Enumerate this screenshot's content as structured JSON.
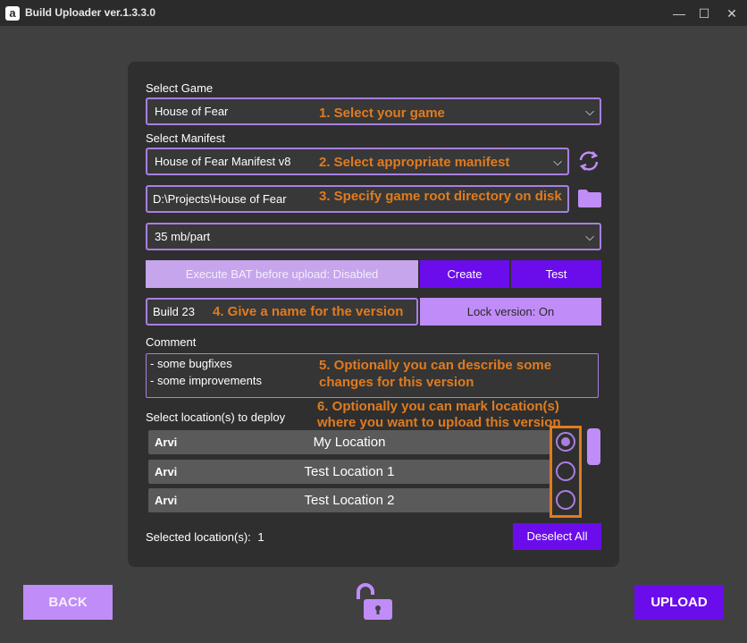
{
  "window": {
    "app_icon_letter": "a",
    "title": "Build Uploader ver.1.3.3.0",
    "minimize": "—",
    "maximize": "☐",
    "close": "✕"
  },
  "form": {
    "select_game_label": "Select Game",
    "game_value": "House of Fear",
    "game_hint": "1. Select your game",
    "select_manifest_label": "Select Manifest",
    "manifest_value": "House of Fear Manifest v8",
    "manifest_hint": "2. Select appropriate manifest",
    "directory_value": "D:\\Projects\\House of Fear",
    "directory_hint": "3. Specify game root directory on disk",
    "part_size_value": "35 mb/part",
    "execute_bat_label": "Execute BAT before upload: Disabled",
    "create_label": "Create",
    "test_label": "Test",
    "version_value": "Build 23",
    "version_hint": "4. Give a name for the version",
    "lock_version_label": "Lock version: On",
    "comment_label": "Comment",
    "comment_line1": "- some bugfixes",
    "comment_line2": "- some improvements",
    "comment_hint_line1": "5. Optionally you can describe some",
    "comment_hint_line2": "changes for this version",
    "locations_label": "Select location(s) to deploy",
    "locations_hint_line1": "6. Optionally you can mark location(s)",
    "locations_hint_line2": "where you want to upload this version",
    "selected_label": "Selected location(s):",
    "selected_count": "1",
    "deselect_all_label": "Deselect All"
  },
  "locations": [
    {
      "owner": "Arvi",
      "name": "My Location",
      "selected": true
    },
    {
      "owner": "Arvi",
      "name": "Test Location 1",
      "selected": false
    },
    {
      "owner": "Arvi",
      "name": "Test Location 2",
      "selected": false
    }
  ],
  "footer": {
    "back_label": "BACK",
    "upload_label": "UPLOAD"
  },
  "icons": {
    "refresh": "refresh-icon",
    "folder": "folder-icon",
    "unlock": "unlock-icon"
  },
  "colors": {
    "accent": "#6a0dea",
    "accent_light": "#c08cf7",
    "hint_orange": "#e07b1f"
  }
}
